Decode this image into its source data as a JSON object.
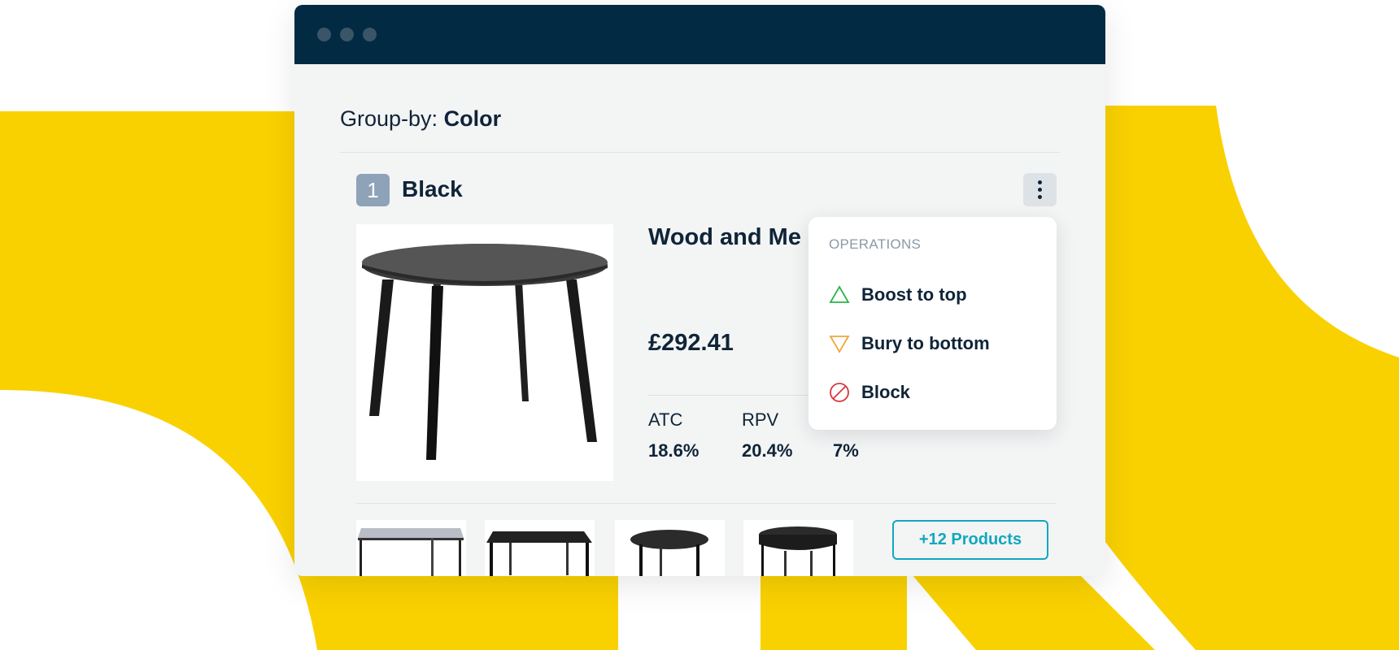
{
  "window": {
    "controls": [
      "close",
      "minimize",
      "maximize"
    ]
  },
  "groupby": {
    "label": "Group-by:",
    "value": "Color"
  },
  "group": {
    "rank": "1",
    "name": "Black",
    "product": {
      "name": "Wood and Me",
      "price": "£292.41",
      "metrics": [
        {
          "label": "ATC",
          "value": "18.6%"
        },
        {
          "label": "RPV",
          "value": "20.4%"
        },
        {
          "label": "",
          "value": "7%"
        }
      ]
    },
    "more_button": "+12 Products"
  },
  "menu": {
    "header": "OPERATIONS",
    "items": [
      {
        "label": "Boost to top",
        "icon": "triangle-up-icon",
        "color": "#2bb34a"
      },
      {
        "label": "Bury to bottom",
        "icon": "triangle-down-icon",
        "color": "#f0a63a"
      },
      {
        "label": "Block",
        "icon": "block-icon",
        "color": "#d9363e"
      }
    ]
  },
  "colors": {
    "accent_yellow": "#f9d100",
    "titlebar": "#032a43",
    "teal": "#11a7c1",
    "badge": "#8ea2b8"
  }
}
